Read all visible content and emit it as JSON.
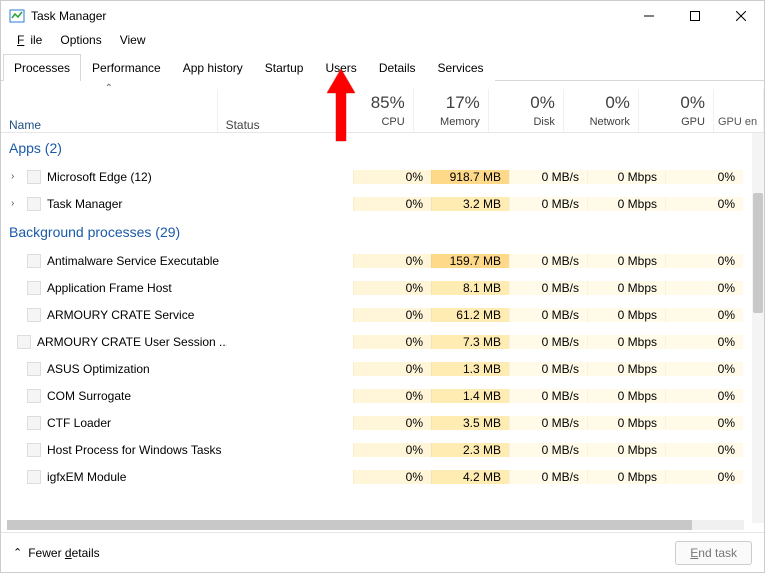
{
  "window": {
    "title": "Task Manager"
  },
  "menu": {
    "file": "File",
    "options": "Options",
    "view": "View"
  },
  "tabs": {
    "processes": "Processes",
    "performance": "Performance",
    "app_history": "App history",
    "startup": "Startup",
    "users": "Users",
    "details": "Details",
    "services": "Services"
  },
  "columns": {
    "name": "Name",
    "status": "Status",
    "cpu_pct": "85%",
    "cpu_label": "CPU",
    "mem_pct": "17%",
    "mem_label": "Memory",
    "disk_pct": "0%",
    "disk_label": "Disk",
    "net_pct": "0%",
    "net_label": "Network",
    "gpu_pct": "0%",
    "gpu_label": "GPU",
    "gpu_engine_label": "GPU en"
  },
  "groups": {
    "apps": "Apps (2)",
    "background": "Background processes (29)"
  },
  "rows": [
    {
      "name": "Microsoft Edge (12)",
      "expandable": true,
      "cpu": "0%",
      "mem": "918.7 MB",
      "mem_hot": true,
      "disk": "0 MB/s",
      "net": "0 Mbps",
      "gpu": "0%"
    },
    {
      "name": "Task Manager",
      "expandable": true,
      "cpu": "0%",
      "mem": "3.2 MB",
      "disk": "0 MB/s",
      "net": "0 Mbps",
      "gpu": "0%"
    },
    {
      "name": "Antimalware Service Executable",
      "cpu": "0%",
      "mem": "159.7 MB",
      "mem_hot": true,
      "disk": "0 MB/s",
      "net": "0 Mbps",
      "gpu": "0%"
    },
    {
      "name": "Application Frame Host",
      "cpu": "0%",
      "mem": "8.1 MB",
      "disk": "0 MB/s",
      "net": "0 Mbps",
      "gpu": "0%"
    },
    {
      "name": "ARMOURY CRATE Service",
      "cpu": "0%",
      "mem": "61.2 MB",
      "disk": "0 MB/s",
      "net": "0 Mbps",
      "gpu": "0%"
    },
    {
      "name": "ARMOURY CRATE User Session ...",
      "cpu": "0%",
      "mem": "7.3 MB",
      "disk": "0 MB/s",
      "net": "0 Mbps",
      "gpu": "0%"
    },
    {
      "name": "ASUS Optimization",
      "cpu": "0%",
      "mem": "1.3 MB",
      "disk": "0 MB/s",
      "net": "0 Mbps",
      "gpu": "0%"
    },
    {
      "name": "COM Surrogate",
      "cpu": "0%",
      "mem": "1.4 MB",
      "disk": "0 MB/s",
      "net": "0 Mbps",
      "gpu": "0%"
    },
    {
      "name": "CTF Loader",
      "cpu": "0%",
      "mem": "3.5 MB",
      "disk": "0 MB/s",
      "net": "0 Mbps",
      "gpu": "0%"
    },
    {
      "name": "Host Process for Windows Tasks",
      "cpu": "0%",
      "mem": "2.3 MB",
      "disk": "0 MB/s",
      "net": "0 Mbps",
      "gpu": "0%"
    },
    {
      "name": "igfxEM Module",
      "cpu": "0%",
      "mem": "4.2 MB",
      "disk": "0 MB/s",
      "net": "0 Mbps",
      "gpu": "0%"
    }
  ],
  "footer": {
    "fewer_details": "Fewer details",
    "end_task": "End task"
  },
  "annotation": {
    "arrow_color": "#ff0000",
    "points_to": "Details tab"
  }
}
